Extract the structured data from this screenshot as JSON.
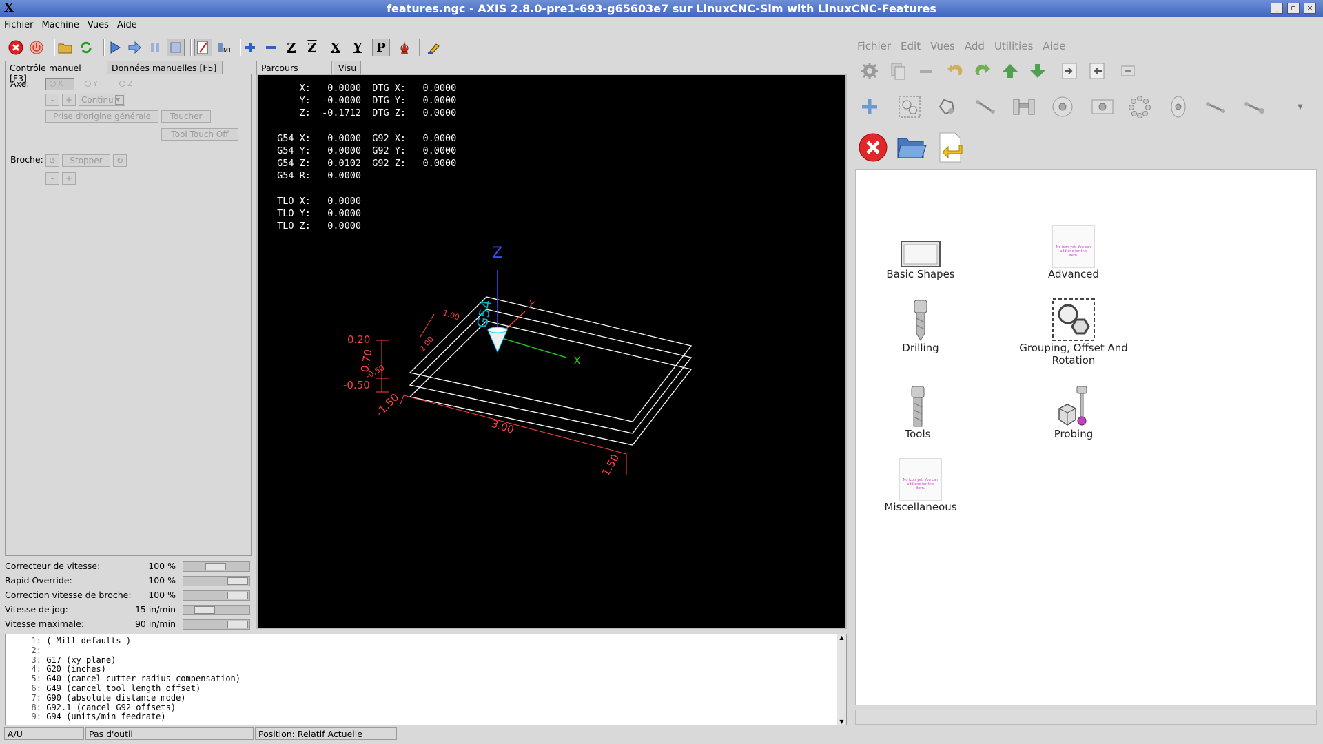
{
  "window": {
    "title": "features.ngc - AXIS 2.8.0-pre1-693-g65603e7 sur LinuxCNC-Sim with LinuxCNC-Features",
    "logo": "X"
  },
  "menubar": [
    "Fichier",
    "Machine",
    "Vues",
    "Aide"
  ],
  "toolbar_icons": [
    "estop-icon",
    "power-icon",
    "open-file-icon",
    "reload-icon",
    "run-icon",
    "step-icon",
    "pause-icon",
    "stop-icon",
    "block-delete-icon",
    "optional-stop-icon",
    "zoom-in-icon",
    "zoom-out-icon",
    "view-z-icon",
    "view-z2-icon",
    "view-x-icon",
    "view-y-icon",
    "view-p-icon",
    "rotate-view-icon",
    "clear-plot-icon"
  ],
  "left_tabs": [
    {
      "label": "Contrôle manuel [F3]",
      "active": true
    },
    {
      "label": "Données manuelles [F5]",
      "active": false
    }
  ],
  "manual": {
    "axis_label": "Axe:",
    "axes": [
      "X",
      "Y",
      "Z"
    ],
    "selected_axis": "X",
    "minus": "-",
    "plus": "+",
    "jog_mode": "Continu",
    "home_all": "Prise d'origine générale",
    "touch": "Toucher",
    "tool_touch_off": "Tool Touch Off",
    "spindle_label": "Broche:",
    "spindle_stop": "Stopper"
  },
  "overrides": [
    {
      "name": "Correcteur de vitesse:",
      "value": "100 %",
      "level": 0.5
    },
    {
      "name": "Rapid Override:",
      "value": "100 %",
      "level": 1.0
    },
    {
      "name": "Correction vitesse de broche:",
      "value": "100 %",
      "level": 1.0
    },
    {
      "name": "Vitesse de jog:",
      "value": "15 in/min",
      "level": 0.25
    },
    {
      "name": "Vitesse maximale:",
      "value": "90 in/min",
      "level": 1.0
    }
  ],
  "preview_tabs": [
    {
      "label": "Parcours d'outil",
      "active": true
    },
    {
      "label": "Visu",
      "active": false
    }
  ],
  "dro": [
    "     X:   0.0000  DTG X:   0.0000",
    "     Y:  -0.0000  DTG Y:   0.0000",
    "     Z:  -0.1712  DTG Z:   0.0000",
    "",
    " G54 X:   0.0000  G92 X:   0.0000",
    " G54 Y:   0.0000  G92 Y:   0.0000",
    " G54 Z:   0.0102  G92 Z:   0.0000",
    " G54 R:   0.0000",
    "",
    " TLO X:   0.0000",
    " TLO Y:   0.0000",
    " TLO Z:   0.0000"
  ],
  "preview_labels": {
    "axis_z": "Z",
    "axis_y": "Y",
    "axis_x": "X",
    "g54": "G54",
    "dims": [
      "0.20",
      "0.70",
      "-0.50",
      "-0.50",
      "-1.50",
      "3.00",
      "1.50",
      "1.00",
      "2.00"
    ]
  },
  "gcode": [
    {
      "n": "1:",
      "text": "( Mill defaults )"
    },
    {
      "n": "2:",
      "text": ""
    },
    {
      "n": "3:",
      "text": "G17 (xy plane)"
    },
    {
      "n": "4:",
      "text": "G20 (inches)"
    },
    {
      "n": "5:",
      "text": "G40 (cancel cutter radius compensation)"
    },
    {
      "n": "6:",
      "text": "G49 (cancel tool length offset)"
    },
    {
      "n": "7:",
      "text": "G90 (absolute distance mode)"
    },
    {
      "n": "8:",
      "text": "G92.1 (cancel G92 offsets)"
    },
    {
      "n": "9:",
      "text": "G94 (units/min feedrate)"
    }
  ],
  "status": [
    "A/U",
    "Pas d'outil",
    "Position: Relatif Actuelle"
  ],
  "features": {
    "menubar": [
      "Fichier",
      "Edit",
      "Vues",
      "Add",
      "Utilities",
      "Aide"
    ],
    "categories": [
      {
        "label": "Basic Shapes",
        "icon": "rectangle-shape-icon"
      },
      {
        "label": "Advanced",
        "icon": "empty-thumbnail-icon",
        "placeholder": "No icon yet. You can add one for this item."
      },
      {
        "label": "Drilling",
        "icon": "drill-bit-icon"
      },
      {
        "label": "Grouping, Offset And Rotation",
        "icon": "grouping-icon"
      },
      {
        "label": "Tools",
        "icon": "endmill-icon"
      },
      {
        "label": "Probing",
        "icon": "probe-icon"
      },
      {
        "label": "Miscellaneous",
        "icon": "empty-thumbnail-icon",
        "placeholder": "No icon yet. You can add one for this item."
      }
    ]
  },
  "colors": {
    "titlebar": "#4a6fc8",
    "preview_bg": "#000000",
    "dim": "#ff4040",
    "axis_x": "#20c020",
    "axis_y": "#ff4040",
    "axis_z": "#3050ff",
    "cone": "#00d0ff"
  }
}
